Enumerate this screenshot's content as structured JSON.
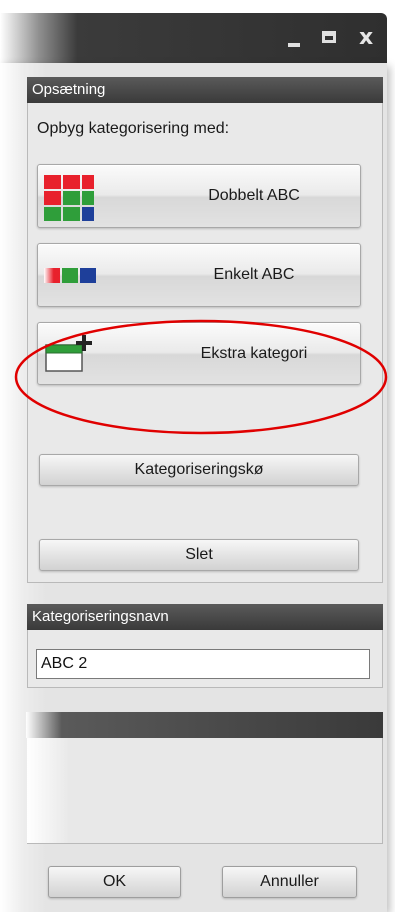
{
  "titlebar": {
    "minimize_icon": "minimize-icon",
    "maximize_icon": "maximize-icon",
    "close_glyph": "x"
  },
  "setup": {
    "header": "Opsætning",
    "build_label": "Opbyg kategorisering med:",
    "buttons": [
      {
        "label": "Dobbelt ABC",
        "icon": "double-abc-grid-icon"
      },
      {
        "label": "Enkelt ABC",
        "icon": "single-abc-bar-icon"
      },
      {
        "label": "Ekstra kategori",
        "icon": "extra-category-add-icon"
      }
    ],
    "queue_button": "Kategoriseringskø",
    "delete_button": "Slet"
  },
  "name_group": {
    "header": "Kategoriseringsnavn",
    "value": "ABC 2"
  },
  "third_group": {
    "header": ""
  },
  "footer": {
    "ok": "OK",
    "cancel": "Annuller"
  },
  "colors": {
    "red": "#e8212c",
    "green": "#2f9e3a",
    "blue": "#1e3f9a",
    "annotation": "#e00000",
    "header": "#3f3f3f"
  }
}
